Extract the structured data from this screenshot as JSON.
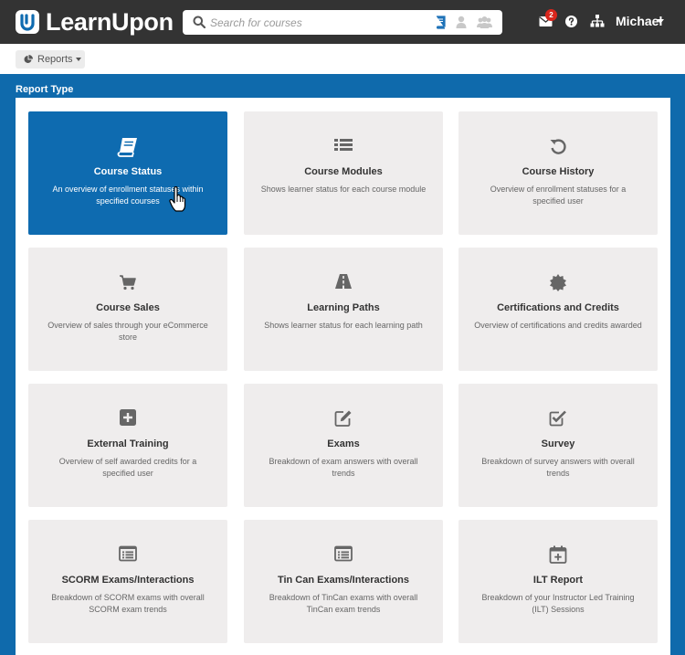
{
  "app": {
    "brand": "LearnUpon",
    "accent_color": "#0e6bb0",
    "topbar_color": "#333333"
  },
  "search": {
    "placeholder": "Search for courses",
    "scopes": [
      "courses-scope-icon",
      "users-scope-icon",
      "groups-scope-icon"
    ]
  },
  "header": {
    "notifications_count": "2",
    "user_name": "Michael"
  },
  "toolbar": {
    "reports_label": "Reports"
  },
  "section": {
    "title": "Report Type"
  },
  "cards": [
    {
      "icon": "book-icon",
      "title": "Course Status",
      "desc": "An overview of enrollment statuses within specified courses",
      "active": true
    },
    {
      "icon": "list-icon",
      "title": "Course Modules",
      "desc": "Shows learner status for each course module"
    },
    {
      "icon": "history-icon",
      "title": "Course History",
      "desc": "Overview of enrollment statuses for a specified user"
    },
    {
      "icon": "cart-icon",
      "title": "Course Sales",
      "desc": "Overview of sales through your eCommerce store"
    },
    {
      "icon": "road-icon",
      "title": "Learning Paths",
      "desc": "Shows learner status for each learning path"
    },
    {
      "icon": "certificate-icon",
      "title": "Certifications and Credits",
      "desc": "Overview of certifications and credits awarded"
    },
    {
      "icon": "plus-square-icon",
      "title": "External Training",
      "desc": "Overview of self awarded credits for a specified user"
    },
    {
      "icon": "edit-icon",
      "title": "Exams",
      "desc": "Breakdown of exam answers with overall trends"
    },
    {
      "icon": "check-square-icon",
      "title": "Survey",
      "desc": "Breakdown of survey answers with overall trends"
    },
    {
      "icon": "list-alt-icon",
      "title": "SCORM Exams/Interactions",
      "desc": "Breakdown of SCORM exams with overall SCORM exam trends"
    },
    {
      "icon": "list-alt-icon",
      "title": "Tin Can Exams/Interactions",
      "desc": "Breakdown of TinCan exams with overall TinCan exam trends"
    },
    {
      "icon": "calendar-plus-icon",
      "title": "ILT Report",
      "desc": "Breakdown of your Instructor Led Training (ILT) Sessions"
    }
  ]
}
